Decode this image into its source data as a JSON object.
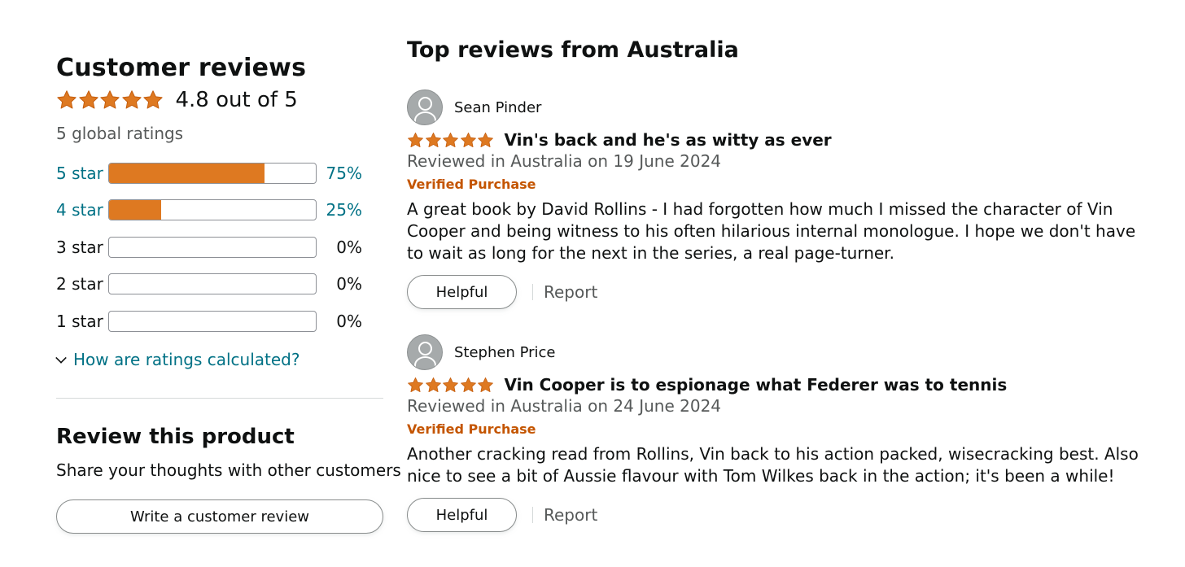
{
  "summary": {
    "title": "Customer reviews",
    "average_text": "4.8 out of 5",
    "average_rating": 4.8,
    "global_ratings": "5 global ratings",
    "star_color": "#de7921",
    "histogram": [
      {
        "label": "5 star",
        "percent": "75%",
        "fill_fraction": 0.75,
        "linked": true
      },
      {
        "label": "4 star",
        "percent": "25%",
        "fill_fraction": 0.25,
        "linked": true
      },
      {
        "label": "3 star",
        "percent": "0%",
        "fill_fraction": 0,
        "linked": false
      },
      {
        "label": "2 star",
        "percent": "0%",
        "fill_fraction": 0,
        "linked": false
      },
      {
        "label": "1 star",
        "percent": "0%",
        "fill_fraction": 0,
        "linked": false
      }
    ],
    "how_calculated": "How are ratings calculated?"
  },
  "review_product": {
    "title": "Review this product",
    "subtitle": "Share your thoughts with other customers",
    "button": "Write a customer review"
  },
  "top_reviews": {
    "title": "Top reviews from Australia",
    "reviews": [
      {
        "reviewer": "Sean Pinder",
        "rating": 5,
        "title": "Vin's back and he's as witty as ever",
        "date": "Reviewed in Australia on 19 June 2024",
        "badge": "Verified Purchase",
        "body": "A great book by David Rollins - I had forgotten how much I missed the character of Vin Cooper and being witness to his often hilarious internal monologue. I hope we don't have to wait as long for the next in the series, a real page-turner.",
        "helpful": "Helpful",
        "report": "Report"
      },
      {
        "reviewer": "Stephen Price",
        "rating": 5,
        "title": "Vin Cooper is to espionage what Federer was to tennis",
        "date": "Reviewed in Australia on 24 June 2024",
        "badge": "Verified Purchase",
        "body": "Another cracking read from Rollins, Vin back to his action packed, wisecracking best. Also nice to see a bit of Aussie flavour with Tom Wilkes back in the action; it's been a while!",
        "helpful": "Helpful",
        "report": "Report"
      }
    ]
  }
}
